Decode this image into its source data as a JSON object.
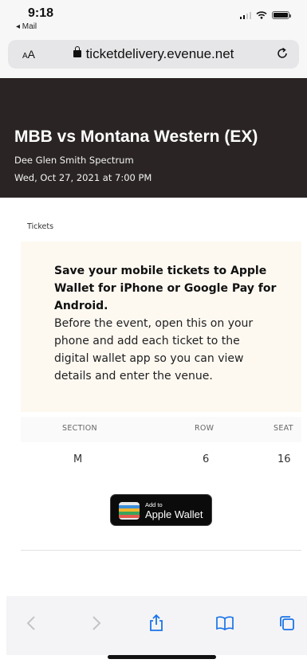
{
  "status_bar": {
    "time": "9:18",
    "back_app": "◂ Mail"
  },
  "browser": {
    "text_size_label_small": "A",
    "text_size_label_large": "A",
    "url": "ticketdelivery.evenue.net"
  },
  "event": {
    "title": "MBB vs Montana Western (EX)",
    "venue": "Dee Glen Smith Spectrum",
    "datetime": "Wed, Oct 27, 2021 at 7:00 PM"
  },
  "tickets_label": "Tickets",
  "notice": {
    "title": "Save your mobile tickets to Apple Wallet for iPhone or Google Pay for Android.",
    "body": "Before the event, open this on your phone and add each ticket to the digital wallet app so you can view details and enter the venue."
  },
  "seat_table": {
    "headers": [
      "SECTION",
      "ROW",
      "SEAT"
    ],
    "values": [
      "M",
      "6",
      "16"
    ]
  },
  "wallet_button": {
    "small_label": "Add to",
    "label": "Apple Wallet"
  },
  "icons": {
    "lock": "lock-icon",
    "reload": "reload-icon",
    "back": "chevron-left-icon",
    "forward": "chevron-right-icon",
    "share": "share-icon",
    "bookmarks": "book-icon",
    "tabs": "tabs-icon"
  },
  "colors": {
    "header_bg": "#2a2524",
    "notice_bg": "#fdf9f1",
    "toolbar_accent": "#1a73e8"
  }
}
